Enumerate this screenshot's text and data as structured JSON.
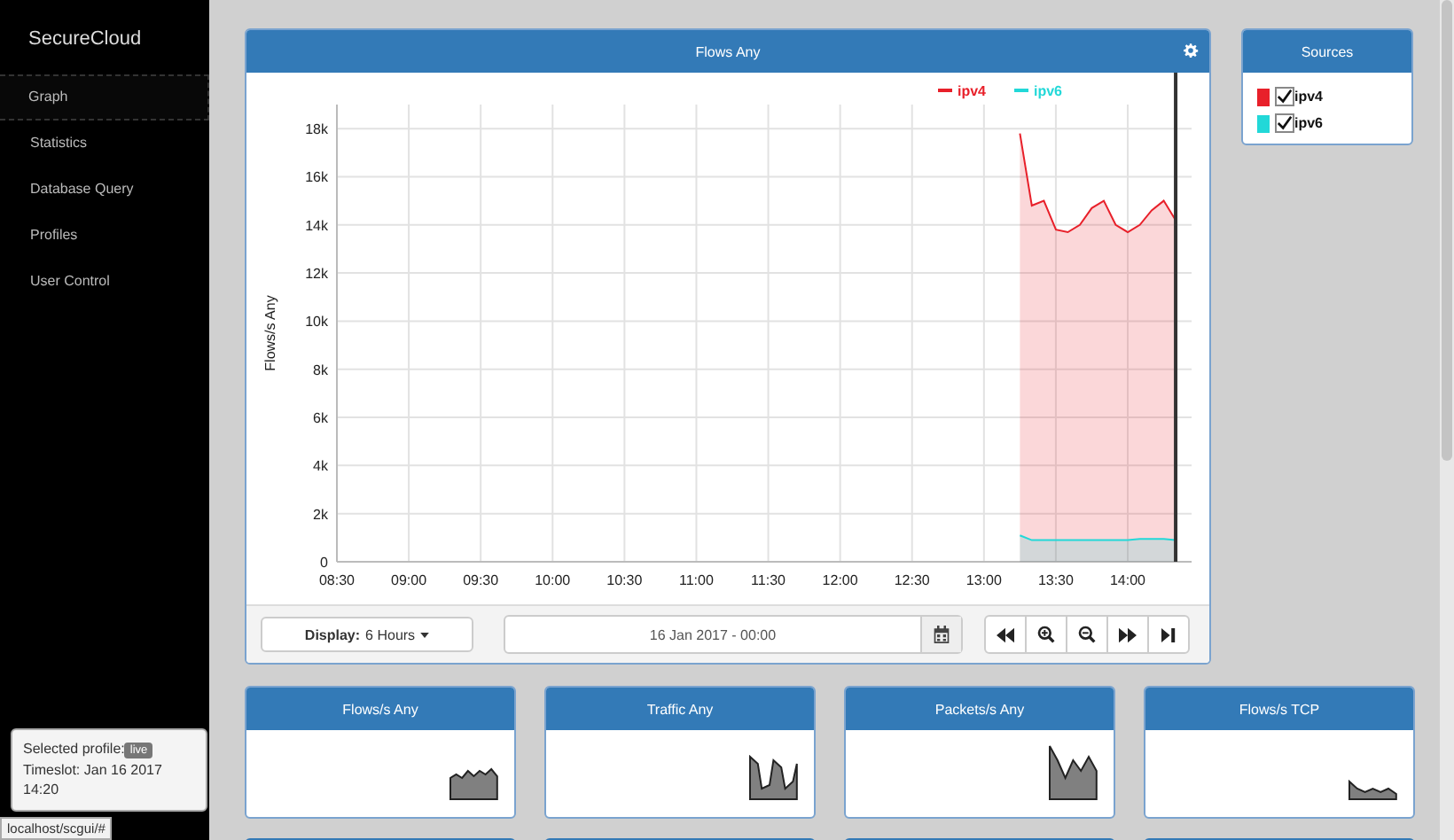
{
  "sidebar": {
    "brand": "SecureCloud",
    "items": [
      {
        "label": "Graph",
        "selected": true
      },
      {
        "label": "Statistics",
        "selected": false
      },
      {
        "label": "Database Query",
        "selected": false
      },
      {
        "label": "Profiles",
        "selected": false
      },
      {
        "label": "User Control",
        "selected": false
      }
    ]
  },
  "profile_box": {
    "label": "Selected profile:",
    "badge": "live",
    "timeslot": "Timeslot: Jan 16 2017 14:20"
  },
  "status_url": "localhost/scgui/#",
  "main_panel": {
    "title": "Flows Any",
    "chart_data": {
      "type": "area",
      "ylabel": "Flows/s Any",
      "categories": [
        "08:30",
        null,
        null,
        null,
        null,
        null,
        "09:00",
        null,
        null,
        null,
        null,
        null,
        "09:30",
        null,
        null,
        null,
        null,
        null,
        "10:00",
        null,
        null,
        null,
        null,
        null,
        "10:30",
        null,
        null,
        null,
        null,
        null,
        "11:00",
        null,
        null,
        null,
        null,
        null,
        "11:30",
        null,
        null,
        null,
        null,
        null,
        "12:00",
        null,
        null,
        null,
        null,
        null,
        "12:30",
        null,
        null,
        null,
        null,
        null,
        "13:00",
        null,
        null,
        null,
        null,
        null,
        "13:30",
        null,
        null,
        null,
        null,
        null,
        "14:00",
        null,
        null,
        null,
        null
      ],
      "series": [
        {
          "name": "ipv4",
          "color": "#e8202a",
          "values": [
            null,
            null,
            null,
            null,
            null,
            null,
            null,
            null,
            null,
            null,
            null,
            null,
            null,
            null,
            null,
            null,
            null,
            null,
            null,
            null,
            null,
            null,
            null,
            null,
            null,
            null,
            null,
            null,
            null,
            null,
            null,
            null,
            null,
            null,
            null,
            null,
            null,
            null,
            null,
            null,
            null,
            null,
            null,
            null,
            null,
            null,
            null,
            null,
            null,
            null,
            null,
            null,
            null,
            null,
            null,
            null,
            null,
            17800,
            14800,
            15000,
            13800,
            13700,
            14000,
            14700,
            15000,
            14000,
            13700,
            14000,
            14600,
            15000,
            14200
          ]
        },
        {
          "name": "ipv6",
          "color": "#22d8d8",
          "values": [
            null,
            null,
            null,
            null,
            null,
            null,
            null,
            null,
            null,
            null,
            null,
            null,
            null,
            null,
            null,
            null,
            null,
            null,
            null,
            null,
            null,
            null,
            null,
            null,
            null,
            null,
            null,
            null,
            null,
            null,
            null,
            null,
            null,
            null,
            null,
            null,
            null,
            null,
            null,
            null,
            null,
            null,
            null,
            null,
            null,
            null,
            null,
            null,
            null,
            null,
            null,
            null,
            null,
            null,
            null,
            null,
            null,
            1100,
            900,
            900,
            900,
            900,
            900,
            900,
            900,
            900,
            900,
            950,
            950,
            950,
            900
          ]
        }
      ],
      "ylim": [
        0,
        19000
      ],
      "grid": true,
      "legend": "top-right",
      "yticks": [
        {
          "value": 0,
          "label": "0"
        },
        {
          "value": 2000,
          "label": "2k"
        },
        {
          "value": 4000,
          "label": "4k"
        },
        {
          "value": 6000,
          "label": "6k"
        },
        {
          "value": 8000,
          "label": "8k"
        },
        {
          "value": 10000,
          "label": "10k"
        },
        {
          "value": 12000,
          "label": "12k"
        },
        {
          "value": 14000,
          "label": "14k"
        },
        {
          "value": 16000,
          "label": "16k"
        },
        {
          "value": 18000,
          "label": "18k"
        }
      ]
    }
  },
  "toolbar": {
    "display_label": "Display:",
    "display_value": "6 Hours",
    "date": "16 Jan 2017 - 00:00"
  },
  "sources": {
    "title": "Sources",
    "items": [
      {
        "name": "ipv4",
        "color": "#e8202a",
        "checked": true
      },
      {
        "name": "ipv6",
        "color": "#22d8d8",
        "checked": true
      }
    ]
  },
  "mini_panels": [
    {
      "title": "Flows/s Any"
    },
    {
      "title": "Traffic Any"
    },
    {
      "title": "Packets/s Any"
    },
    {
      "title": "Flows/s TCP"
    }
  ]
}
